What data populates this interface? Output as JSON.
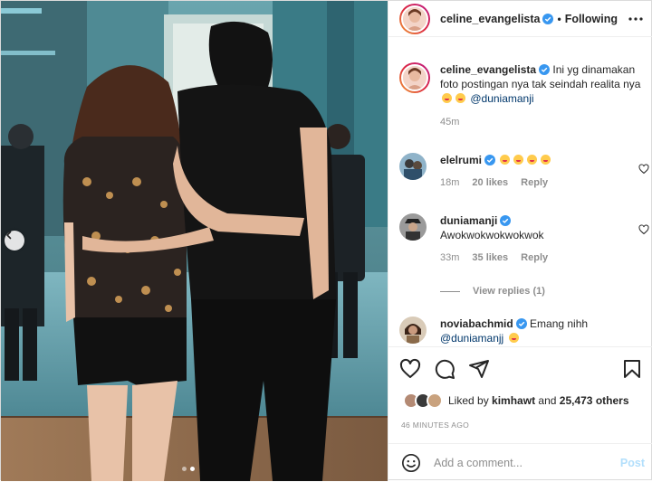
{
  "post": {
    "author": "celine_evangelista",
    "separator": "•",
    "follow_status": "Following",
    "caption_text": "Ini yg dinamakan foto postingan nya tak seindah realita nya",
    "caption_mention": "@duniamanji",
    "caption_time": "45m"
  },
  "comments": [
    {
      "user": "elelrumi",
      "text": "",
      "time": "18m",
      "likes": "20 likes",
      "reply": "Reply"
    },
    {
      "user": "duniamanji",
      "text": "Awokwokwokwokwok",
      "time": "33m",
      "likes": "35 likes",
      "reply": "Reply"
    },
    {
      "user": "noviabachmid",
      "text": "Emang nihh",
      "mention": "@duniamanjj"
    }
  ],
  "view_replies": "View replies (1)",
  "likes": {
    "prefix": "Liked by",
    "user": "kimhawt",
    "middle": "and",
    "count": "25,473 others"
  },
  "timestamp": "46 MINUTES AGO",
  "comment_box": {
    "placeholder": "Add a comment...",
    "post_label": "Post"
  },
  "carousel": {
    "slides": 2,
    "active": 1
  },
  "colors": {
    "link": "#00376b",
    "muted": "#8e8e8e",
    "verified": "#3897f0",
    "post_disabled": "#b2dffc"
  },
  "icons": [
    "more-options-icon",
    "heart-icon",
    "comment-icon",
    "share-icon",
    "save-icon",
    "emoji-icon",
    "verified-icon",
    "chevron-left-icon"
  ]
}
